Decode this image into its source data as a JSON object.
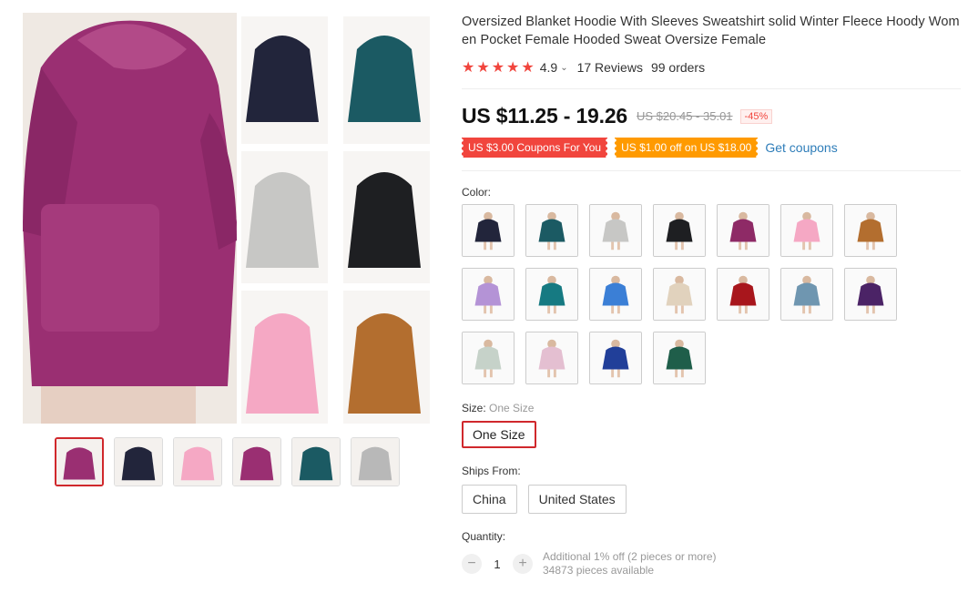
{
  "product": {
    "title": "Oversized Blanket Hoodie With Sleeves Sweatshirt solid Winter Fleece Hoody Women Pocket Female Hooded Sweat Oversize Female",
    "rating": "4.9",
    "reviews": "17 Reviews",
    "orders": "99 orders",
    "price": "US $11.25 - 19.26",
    "old_price": "US $20.45 - 35.01",
    "discount": "-45%"
  },
  "coupons": {
    "coupon1": "US $3.00 Coupons For You",
    "coupon2": "US $1.00 off on US $18.00",
    "get_coupons": "Get coupons"
  },
  "color_label": "Color:",
  "colors": [
    "#22253b",
    "#1b5a63",
    "#c7c7c5",
    "#1e1f22",
    "#8e2a66",
    "#f5a8c4",
    "#b36e2f",
    "#b493d6",
    "#167a82",
    "#3b7fd6",
    "#e1d2bd",
    "#a8161c",
    "#6f96b0",
    "#4b2366",
    "#c6d2c9",
    "#e4bfd1",
    "#213f99",
    "#1f5e4a"
  ],
  "size": {
    "label": "Size:",
    "value": "One Size",
    "option": "One Size"
  },
  "ships": {
    "label": "Ships From:",
    "options": [
      "China",
      "United States"
    ]
  },
  "quantity": {
    "label": "Quantity:",
    "value": "1",
    "minus": "−",
    "plus": "+",
    "note": "Additional 1% off (2 pieces or more)",
    "available": "34873 pieces available"
  },
  "thumbs": [
    "#9a2f72",
    "#22253b",
    "#f5a8c4",
    "#9a2f72",
    "#1b5a63",
    "#b8b8b8"
  ]
}
